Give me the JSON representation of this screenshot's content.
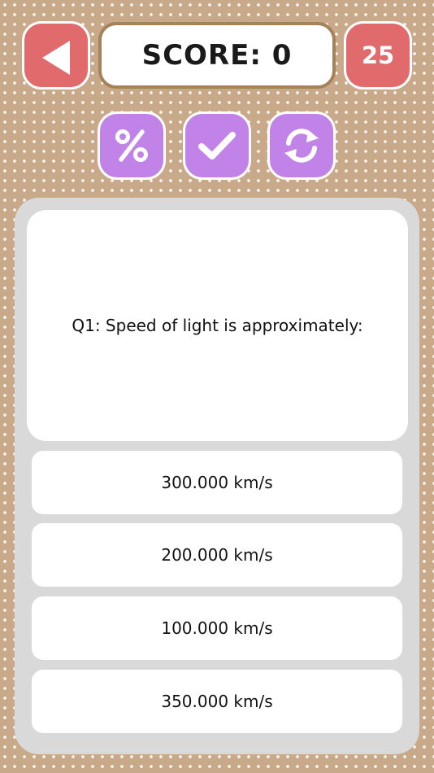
{
  "header": {
    "back_icon": "arrow-left-icon",
    "score_label": "SCORE: 0",
    "counter_value": "25"
  },
  "toolbar": {
    "buttons": [
      {
        "icon": "percent-icon"
      },
      {
        "icon": "checkmark-icon"
      },
      {
        "icon": "refresh-icon"
      }
    ]
  },
  "quiz": {
    "question": "Q1: Speed of light is approximately:",
    "answers": [
      "300.000 km/s",
      "200.000 km/s",
      "100.000 km/s",
      "350.000 km/s"
    ]
  },
  "colors": {
    "background": "#c8a98a",
    "red_button": "#e06a6c",
    "purple_button": "#c183e8",
    "score_border": "#a6825a",
    "panel": "#d9d9d9"
  }
}
